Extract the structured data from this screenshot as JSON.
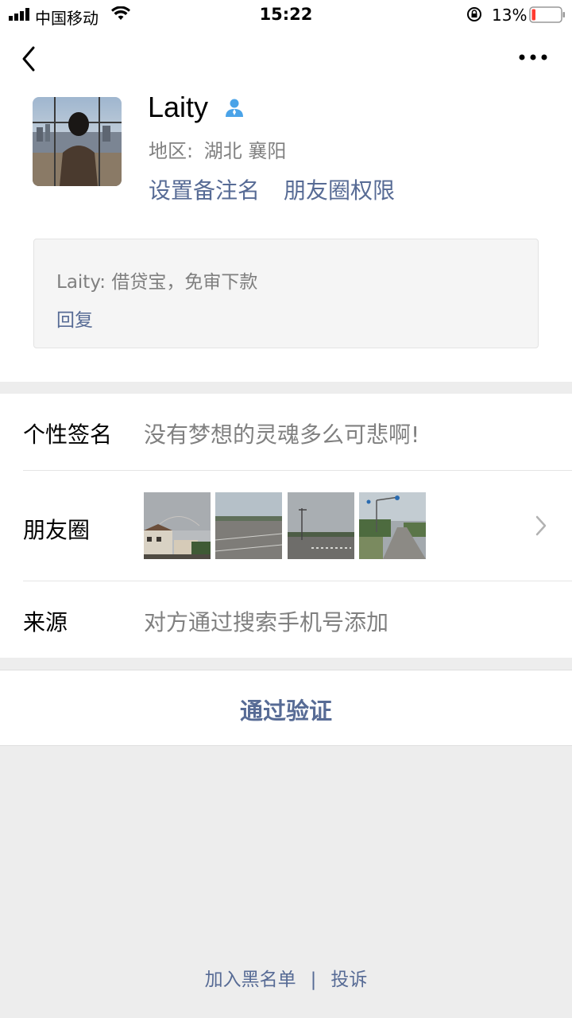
{
  "status_bar": {
    "carrier": "中国移动",
    "time": "15:22",
    "battery_percent": "13%",
    "battery_level": 0.13,
    "battery_color": "#ff3b30"
  },
  "nav": {
    "back_icon": "chevron-left-icon",
    "more_icon": "more-dots-icon"
  },
  "profile": {
    "name": "Laity",
    "region_label": "地区:",
    "region_value": "湖北 襄阳",
    "set_remark": "设置备注名",
    "moments_permission": "朋友圈权限"
  },
  "message": {
    "text": "Laity: 借贷宝，免审下款",
    "reply": "回复"
  },
  "info": {
    "signature_label": "个性签名",
    "signature_value": "没有梦想的灵魂多么可悲啊!",
    "moments_label": "朋友圈",
    "source_label": "来源",
    "source_value": "对方通过搜索手机号添加"
  },
  "actions": {
    "verify": "通过验证"
  },
  "footer": {
    "blacklist": "加入黑名单",
    "separator": "|",
    "report": "投诉"
  },
  "colors": {
    "link": "#576b95",
    "secondary_text": "#808080",
    "background": "#ededed"
  }
}
